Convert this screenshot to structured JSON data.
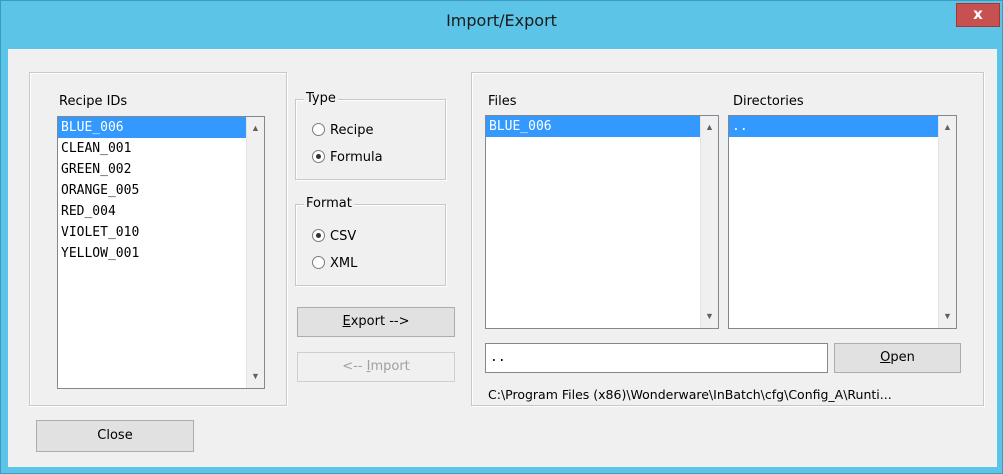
{
  "window": {
    "title": "Import/Export",
    "close_glyph": "x"
  },
  "recipe_ids": {
    "label": "Recipe IDs",
    "items": [
      "BLUE_006",
      "CLEAN_001",
      "GREEN_002",
      "ORANGE_005",
      "RED_004",
      "VIOLET_010",
      "YELLOW_001"
    ],
    "selected_index": 0
  },
  "type_group": {
    "title": "Type",
    "options": [
      "Recipe",
      "Formula"
    ],
    "selected": "Formula"
  },
  "format_group": {
    "title": "Format",
    "options": [
      "CSV",
      "XML"
    ],
    "selected": "CSV"
  },
  "buttons": {
    "export_prefix": "E",
    "export_rest": "xport -->",
    "import_prefix": "<-- ",
    "import_ul": "I",
    "import_rest": "mport",
    "open_ul": "O",
    "open_rest": "pen",
    "close": "Close"
  },
  "files": {
    "label": "Files",
    "items": [
      "BLUE_006"
    ],
    "selected_index": 0
  },
  "directories": {
    "label": "Directories",
    "items": [
      ".."
    ],
    "selected_index": 0
  },
  "path_input": {
    "value": ".."
  },
  "current_path": "C:\\Program Files (x86)\\Wonderware\\InBatch\\cfg\\Config_A\\Runti..."
}
